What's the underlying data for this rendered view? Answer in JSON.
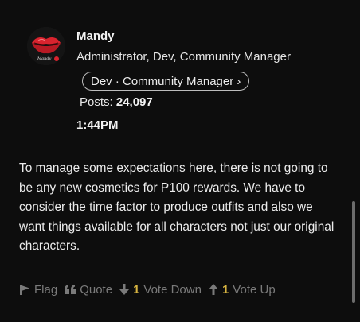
{
  "author": {
    "name": "Mandy",
    "roles": "Administrator, Dev, Community Manager",
    "rank_badge": "Dev · Community Manager ›",
    "posts_label": "Posts:",
    "posts_count": "24,097",
    "avatar_text": "Mandy",
    "avatar_icon": "red-lips-logo-icon"
  },
  "post": {
    "time": "1:44PM",
    "body": "To manage some expectations here, there is not going to be any new cosmetics for P100 rewards. We have to consider the time factor to produce outfits and also we want things available for all characters not just our original characters."
  },
  "actions": {
    "flag_label": "Flag",
    "quote_label": "Quote",
    "vote_down_count": "1",
    "vote_down_label": "Vote Down",
    "vote_up_count": "1",
    "vote_up_label": "Vote Up"
  },
  "colors": {
    "background": "#0d0d0d",
    "text": "#e8e8e8",
    "muted": "#7a7a7a",
    "vote_count": "#d7b441",
    "avatar_lips": "#d9232e"
  }
}
